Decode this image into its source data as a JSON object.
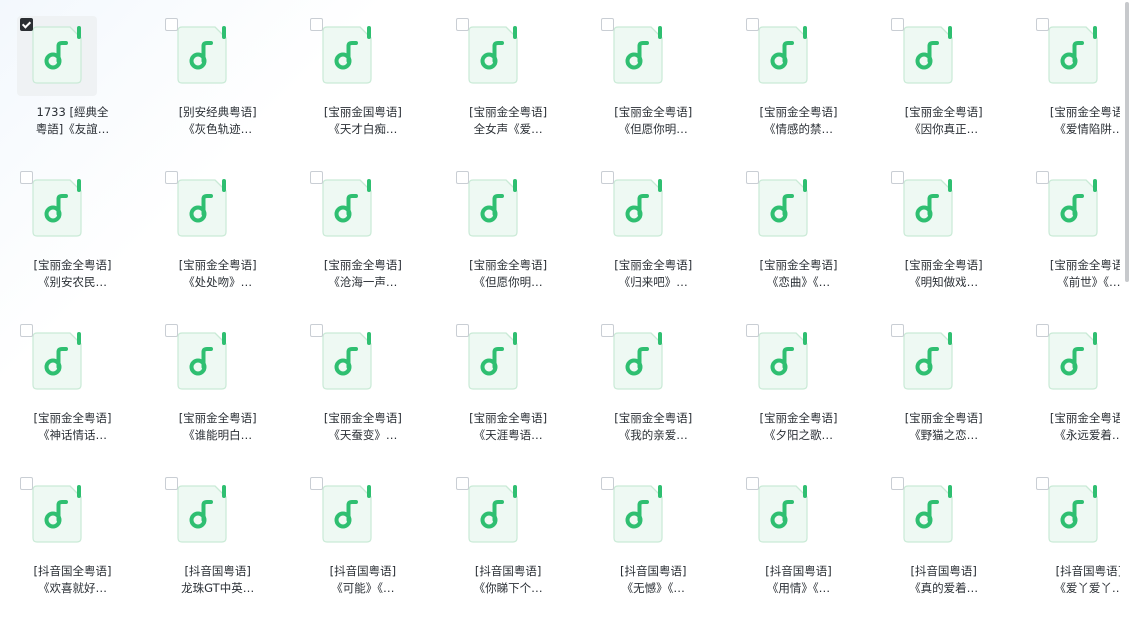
{
  "selected_index": 0,
  "icon": "music-file-icon",
  "colors": {
    "icon_green": "#2fbf71",
    "icon_page": "#eef9f3",
    "icon_border": "#c9ead6"
  },
  "files": [
    {
      "line1": "1733 [經典全",
      "line2": "粵語]《友誼…"
    },
    {
      "line1": "[别安经典粤语]",
      "line2": "《灰色轨迹…"
    },
    {
      "line1": "[宝丽金国粤语]",
      "line2": "《天才白痴…"
    },
    {
      "line1": "[宝丽金全粤语]",
      "line2": "全女声《爱…"
    },
    {
      "line1": "[宝丽金全粤语]",
      "line2": "《但愿你明…"
    },
    {
      "line1": "[宝丽金全粤语]",
      "line2": "《情感的禁…"
    },
    {
      "line1": "[宝丽金全粤语]",
      "line2": "《因你真正…"
    },
    {
      "line1": "[宝丽金全粤语]",
      "line2": "《爱情陷阱…"
    },
    {
      "line1": "[宝丽金全粤语]",
      "line2": "《别安农民…"
    },
    {
      "line1": "[宝丽金全粤语]",
      "line2": "《处处吻》…"
    },
    {
      "line1": "[宝丽金全粤语]",
      "line2": "《沧海一声…"
    },
    {
      "line1": "[宝丽金全粤语]",
      "line2": "《但愿你明…"
    },
    {
      "line1": "[宝丽金全粤语]",
      "line2": "《归来吧》…"
    },
    {
      "line1": "[宝丽金全粤语]",
      "line2": "《恋曲》《…"
    },
    {
      "line1": "[宝丽金全粤语]",
      "line2": "《明知做戏…"
    },
    {
      "line1": "[宝丽金全粤语]",
      "line2": "《前世》《…"
    },
    {
      "line1": "[宝丽金全粤语]",
      "line2": "《神话情话…"
    },
    {
      "line1": "[宝丽金全粤语]",
      "line2": "《谁能明白…"
    },
    {
      "line1": "[宝丽金全粤语]",
      "line2": "《天蚕变》…"
    },
    {
      "line1": "[宝丽金全粤语]",
      "line2": "《天涯粤语…"
    },
    {
      "line1": "[宝丽金全粤语]",
      "line2": "《我的亲爱…"
    },
    {
      "line1": "[宝丽金全粤语]",
      "line2": "《夕阳之歌…"
    },
    {
      "line1": "[宝丽金全粤语]",
      "line2": "《野猫之恋…"
    },
    {
      "line1": "[宝丽金全粤语]",
      "line2": "《永远爱着…"
    },
    {
      "line1": "[抖音国全粤语]",
      "line2": "《欢喜就好…"
    },
    {
      "line1": "[抖音国粤语]",
      "line2": "龙珠GT中英…"
    },
    {
      "line1": "[抖音国粤语]",
      "line2": "《可能》《…"
    },
    {
      "line1": "[抖音国粤语]",
      "line2": "《你睇下个…"
    },
    {
      "line1": "[抖音国粤语]",
      "line2": "《无憾》《…"
    },
    {
      "line1": "[抖音国粤语]",
      "line2": "《用情》《…"
    },
    {
      "line1": "[抖音国粤语]",
      "line2": "《真的爱着…"
    },
    {
      "line1": "[抖音国粤语]",
      "line2": "《爱丫爱丫…"
    }
  ]
}
